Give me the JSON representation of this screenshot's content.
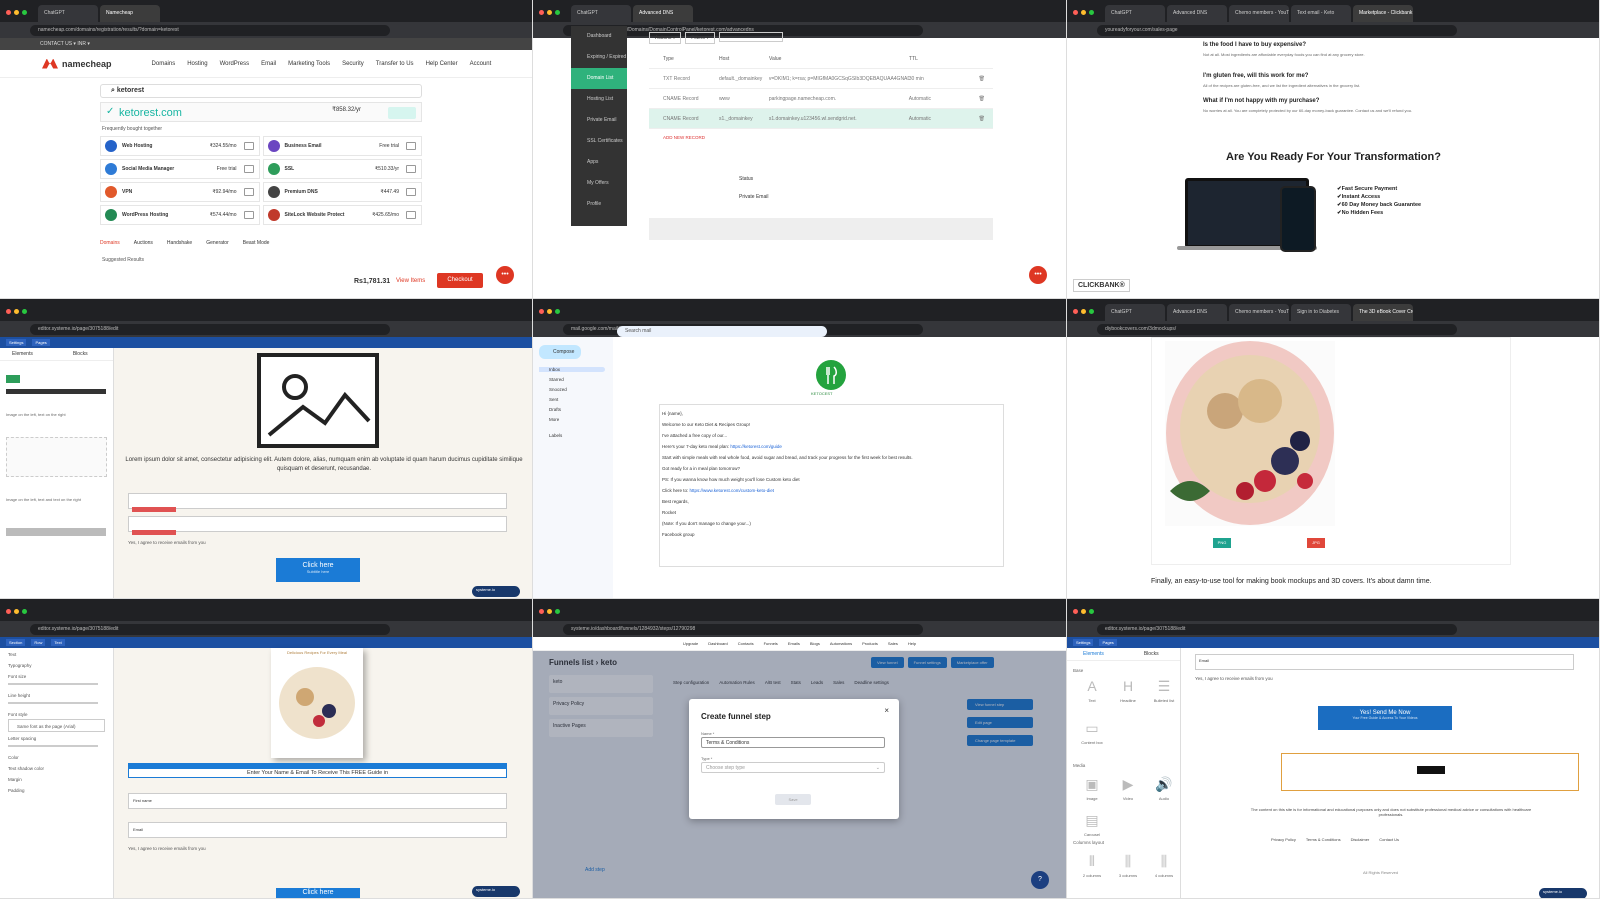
{
  "tiles": {
    "namecheap": {
      "tabs": [
        "ChatGPT",
        "Namecheap"
      ],
      "url": "namecheap.com/domains/registration/results/?domain=ketorest",
      "top_bar": "CONTACT US ▾   INR ▾",
      "logo": "namecheap",
      "menu": [
        "Domains",
        "Hosting",
        "WordPress",
        "Email",
        "Marketing Tools",
        "Security",
        "Transfer to Us",
        "Help Center",
        "Account"
      ],
      "search_value": "ketorest",
      "domain_result": "ketorest.com",
      "domain_price": "₹858.32/yr",
      "frequently_bought": "Frequently bought together",
      "products": [
        {
          "name": "Web Hosting",
          "price": "₹324.55/mo",
          "color": "#2563c9"
        },
        {
          "name": "Business Email",
          "price": "Free trial",
          "color": "#6b46c1"
        },
        {
          "name": "Social Media Manager",
          "price": "Free trial",
          "color": "#2e7bd6"
        },
        {
          "name": "SSL",
          "price": "₹510.33/yr",
          "color": "#2e9d5b"
        },
        {
          "name": "VPN",
          "price": "₹92.94/mo",
          "color": "#e1592b"
        },
        {
          "name": "Premium DNS",
          "price": "₹447.49",
          "color": "#444444"
        },
        {
          "name": "WordPress Hosting",
          "price": "₹574.44/mo",
          "color": "#238a54"
        },
        {
          "name": "SiteLock Website Protect",
          "price": "₹425.65/mo",
          "color": "#c0392b"
        }
      ],
      "bottom_tabs": [
        "Domains",
        "Auctions",
        "Handshake",
        "Generator",
        "Beast Mode"
      ],
      "suggested": "Suggested Results",
      "total": "Rs1,781.31",
      "view_items": "View Items",
      "checkout": "Checkout"
    },
    "dns": {
      "tabs": [
        "ChatGPT",
        "Advanced DNS"
      ],
      "url": "ap.www.namecheap.com/Domains/DomainControlPanel/ketorest.com/advancedns",
      "sidebar": [
        "Dashboard",
        "Expiring / Expired",
        "Domain List",
        "Hosting List",
        "Private Email",
        "SSL Certificates",
        "Apps",
        "My Offers",
        "Profile"
      ],
      "actions": "Actions ▾",
      "filters": "Filters ▾",
      "headers": [
        "Type",
        "Host",
        "Value",
        "TTL"
      ],
      "records": [
        {
          "type": "TXT Record",
          "host": "default._domainkey",
          "value": "v=DKIM1; k=rsa; p=MIGfMA0GCSqGSIb3DQEBAQUAA4GNADCBiQ...",
          "ttl": "30 min"
        },
        {
          "type": "CNAME Record",
          "host": "www",
          "value": "parkingpage.namecheap.com.",
          "ttl": "Automatic"
        },
        {
          "type": "CNAME Record",
          "host": "s1._domainkey",
          "value": "s1.domainkey.u123456.wl.sendgrid.net.",
          "ttl": "Automatic"
        }
      ],
      "add_record": "ADD NEW RECORD",
      "status": "Status",
      "private_email": "Private Email"
    },
    "sales": {
      "tabs": [
        "ChatGPT",
        "Advanced DNS",
        "Chemo members - YouTube",
        "Text email - Keto",
        "Marketplace - Clickbank"
      ],
      "url": "youreadyforyour.com/sales-page",
      "faq": [
        {
          "q": "Is the food I have to buy expensive?",
          "a": "Not at all. Most ingredients are affordable everyday foods you can find at any grocery store."
        },
        {
          "q": "I'm gluten free, will this work for me?",
          "a": "All of the recipes are gluten-free, and we list the ingredient alternatives in the grocery list."
        },
        {
          "q": "What if I'm not happy with my purchase?",
          "a": "No worries at all. You are completely protected by our 60-day money-back guarantee. Contact us and we'll refund you."
        }
      ],
      "heading": "Are You Ready For Your Transformation?",
      "features": [
        "✔Fast Secure Payment",
        "✔Instant Access",
        "✔60 Day Money back Guarantee",
        "✔No Hidden Fees"
      ],
      "clickbank": "CLICKBANK®"
    },
    "editor1": {
      "url": "editor.systeme.io/page/3075188/edit",
      "toolbar": [
        "Settings",
        "Pages"
      ],
      "left_tabs": [
        "Elements",
        "Blocks"
      ],
      "lorem": "Lorem ipsum dolor sit amet, consectetur adipisicing elit. Autem dolore, alias, numquam enim ab voluptate id quam harum ducimus cupiditate similique quisquam et deserunt, recusandae.",
      "agree": "Yes, I agree to receive emails from you",
      "button_label": "Click here",
      "button_sub": "Subtitle here",
      "left_caption_1": "Image on the left, text on the right",
      "left_caption_2": "Image on the left, text and text on the right",
      "badge": "systeme.io"
    },
    "gmail": {
      "url": "mail.google.com/mail/u/0/#inbox",
      "search": "Search mail",
      "compose": "Compose",
      "folders": [
        "Inbox",
        "Starred",
        "Snoozed",
        "Sent",
        "Drafts",
        "More"
      ],
      "labels": "Labels",
      "logo_text": "KETOCEST",
      "lines": [
        "Hi {name},",
        "Welcome to our Keto Diet & Recipes Group!",
        "I've attached a free copy of our...",
        "Here's your 7-day keto meal plan: https://ketorest.com/guide",
        "Start with simple meals with real whole food, avoid sugar and bread, and track your progress for the first week for best results.",
        "Got ready for a in meal plan tomorrow?",
        "PS: If you wanna know how much weight you'll lose Custom keto diet",
        "Click here to: https://www.ketorest.com/custom-keto-diet",
        "Best regards,",
        "Rocket",
        "(Note: If you don't manage to change your...)",
        "Facebook group"
      ]
    },
    "mockup": {
      "tabs": [
        "ChatGPT",
        "Advanced DNS",
        "Chemo members - YouTube",
        "Sign in to Diabetes",
        "The 3D eBook Cover Creator"
      ],
      "url": "diybookcovers.com/3dmockups/",
      "png": "PNG",
      "jpg": "JPG",
      "finally": "Finally, an easy-to-use tool for making book mockups and 3D covers. It's about damn time."
    },
    "editor2": {
      "url": "editor.systeme.io/page/3075188/edit",
      "crumbs": [
        "Section",
        "Row",
        "Text"
      ],
      "panel": [
        "Text",
        "Typography",
        "Font size",
        "Line height",
        "Font style",
        "Same font as the page (Arial)",
        "Letter spacing",
        "Color",
        "Text shadow color",
        "Margin",
        "Padding"
      ],
      "book_title": "Delicious Recipes For Every Meal",
      "headline": "Enter Your Name & Email To Receive This FREE Guide in",
      "first_name": "First name",
      "email": "Email",
      "agree": "Yes, I agree to receive emails from you",
      "button_label": "Click here"
    },
    "funnel": {
      "url": "systeme.io/dashboard/funnels/1284932/steps/12790298",
      "nav": [
        "Upgrade",
        "Dashboard",
        "Contacts",
        "Funnels",
        "Emails",
        "Blogs",
        "Automations",
        "Products",
        "Sales",
        "Help"
      ],
      "title": "Funnels list",
      "funnel_name": "keto",
      "steps": [
        "keto",
        "Privacy Policy",
        "Inactive Pages"
      ],
      "tabs": [
        "Step configuration",
        "Automation Rules",
        "A/B test",
        "Stats",
        "Leads",
        "Sales",
        "Deadline settings"
      ],
      "modal_title": "Create funnel step",
      "name_label": "Name *",
      "name_value": "Terms & Conditions",
      "type_label": "Type *",
      "type_placeholder": "Choose step type",
      "save": "Save",
      "side_buttons": [
        "View funnel step",
        "Edit page",
        "Change page template"
      ],
      "add_step": "Add step",
      "top_buttons": [
        "View funnel",
        "Funnel settings",
        "Marketplace offer"
      ]
    },
    "editor3": {
      "url": "editor.systeme.io/page/3075188/edit",
      "palette_tabs": [
        "Elements",
        "Blocks"
      ],
      "sections": [
        "Base",
        "Media",
        "Columns layout"
      ],
      "items": [
        "Text",
        "Headline",
        "Bulleted list",
        "Content box",
        "Image",
        "Video",
        "Audio",
        "Carousel",
        "2 columns",
        "3 columns",
        "4 columns"
      ],
      "email_field": "Email",
      "agree": "Yes, I agree to receive emails from you",
      "cta": "Yes! Send Me Now",
      "cta_sub": "Your Free Guide & Access To Your Videos",
      "disclaimer": "The content on this site is for informational and educational purposes only and does not substitute professional medical advice or consultations with healthcare professionals.",
      "links": [
        "Privacy Policy",
        "Terms & Conditions",
        "Disclaimer",
        "Contact Us"
      ],
      "copyright": "All Rights Reserved",
      "badge": "systeme.io"
    }
  }
}
